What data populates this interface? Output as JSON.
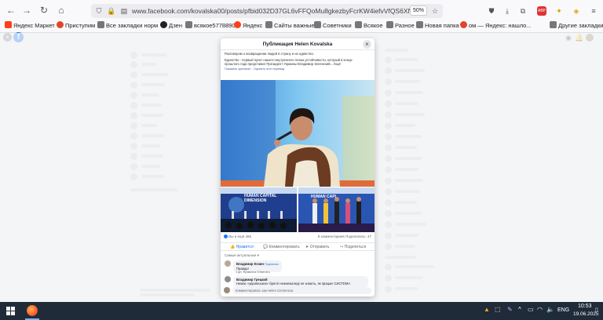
{
  "browser": {
    "url": "www.facebook.com/kovalska00/posts/pfbid032D37GL6vFFQoMu8gkezbyFcrKW4iefvVfQS6XN87Y4JYC",
    "zoom": "50%",
    "bookmarks": [
      "Яндекс Маркет",
      "Приступим",
      "Все закладки норм",
      "Дзен",
      "всякое5778890",
      "Яндекс",
      "Сайты важные",
      "Советники",
      "Всякое",
      "Разное",
      "Новая папка",
      "ом — Яндекс: нашло...",
      "Другие закладки"
    ]
  },
  "modal": {
    "title": "Публикация Helen Kovalska",
    "text_lines": [
      "Разговором о возвращении людей в страну и их единство.",
      "Единство - первый пункт нашего внутреннего плана устойчивости, который в конце",
      "прошлого года представил Президент Украины Владимир Зеленский... Ещё"
    ],
    "translate_link": "Показать оригинал · Оценить этот перевод",
    "slides": [
      "HUMAN CAPITAL",
      "DIMENSION",
      "HUMAN CAPI"
    ],
    "reactions": "Вы и ещё 465",
    "comments_count": "8 комментариев  Поделились: 47",
    "actions": [
      "Нравится",
      "Комментировать",
      "Отправить",
      "Поделиться"
    ],
    "sort_label": "Самые актуальные ▾",
    "comments": [
      {
        "author": "Владимир Козин",
        "badge": "Подписчик",
        "text": "Правда!",
        "meta": "1 дн.   Нравится   Ответить"
      },
      {
        "author": "Владимир Грецкий",
        "text": "Немає «українських» бреглі нежнежаледі не знають, як працює СИСТЕМА"
      }
    ],
    "write_placeholder": "Комментировать как Helen Cemenova"
  },
  "taskbar": {
    "lang": "ENG",
    "time": "10:53",
    "date": "19.06.2025"
  }
}
